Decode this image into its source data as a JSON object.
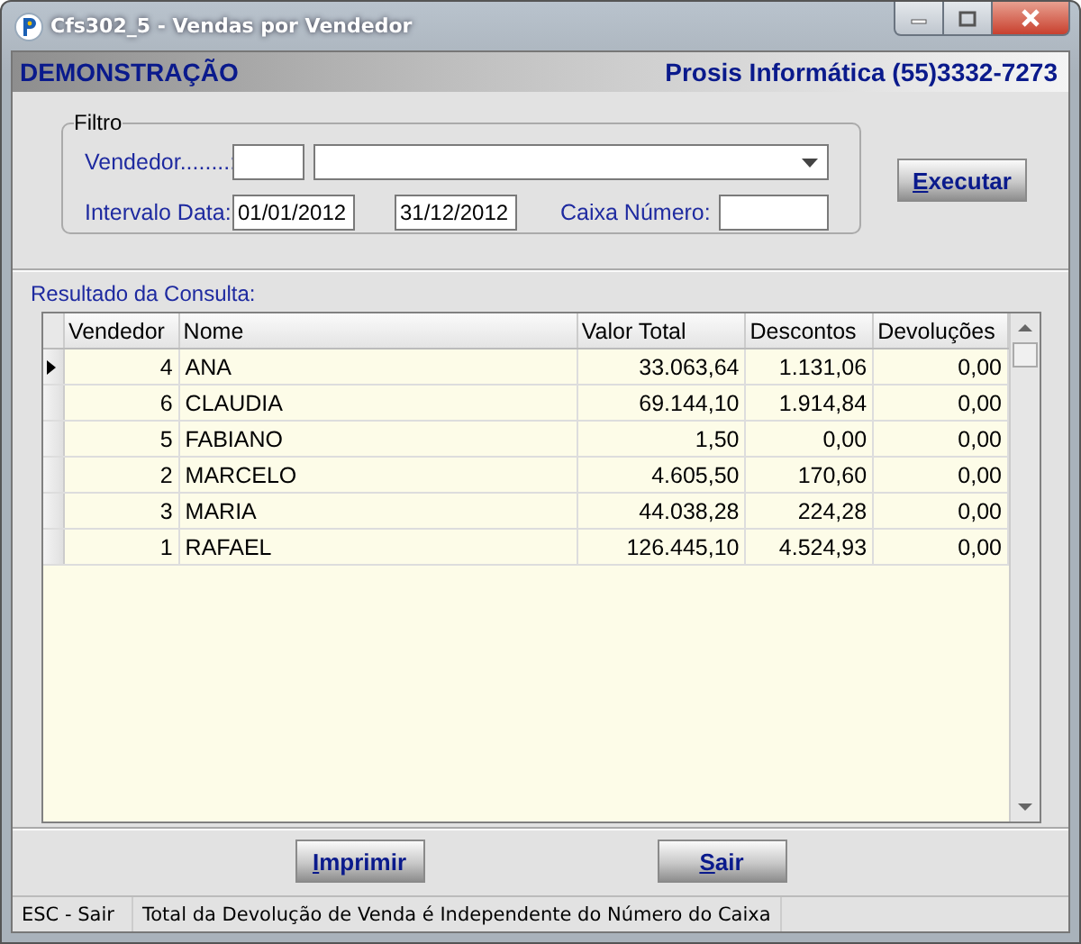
{
  "window": {
    "title": "Cfs302_5 - Vendas por Vendedor"
  },
  "header": {
    "left": "DEMONSTRAÇÃO",
    "right": "Prosis Informática (55)3332-7273"
  },
  "filter": {
    "legend": "Filtro",
    "vendedor_label": "Vendedor........:",
    "data_label": "Intervalo Data:",
    "date_from": "01/01/2012",
    "date_to": "31/12/2012",
    "caixa_label": "Caixa Número:"
  },
  "execute_button": "Executar",
  "result_label": "Resultado da Consulta:",
  "table": {
    "columns": [
      "Vendedor",
      "Nome",
      "Valor Total",
      "Descontos",
      "Devoluções"
    ],
    "rows": [
      {
        "cells": [
          "4",
          "ANA",
          "33.063,64",
          "1.131,06",
          "0,00"
        ],
        "selected": true
      },
      {
        "cells": [
          "6",
          "CLAUDIA",
          "69.144,10",
          "1.914,84",
          "0,00"
        ],
        "selected": false
      },
      {
        "cells": [
          "5",
          "FABIANO",
          "1,50",
          "0,00",
          "0,00"
        ],
        "selected": false
      },
      {
        "cells": [
          "2",
          "MARCELO",
          "4.605,50",
          "170,60",
          "0,00"
        ],
        "selected": false
      },
      {
        "cells": [
          "3",
          "MARIA",
          "44.038,28",
          "224,28",
          "0,00"
        ],
        "selected": false
      },
      {
        "cells": [
          "1",
          "RAFAEL",
          "126.445,10",
          "4.524,93",
          "0,00"
        ],
        "selected": false
      }
    ]
  },
  "buttons": [
    "Imprimir",
    "Sair"
  ],
  "status_bar": [
    "ESC - Sair",
    "Total da Devolução de Venda é Independente do Número do Caixa"
  ]
}
